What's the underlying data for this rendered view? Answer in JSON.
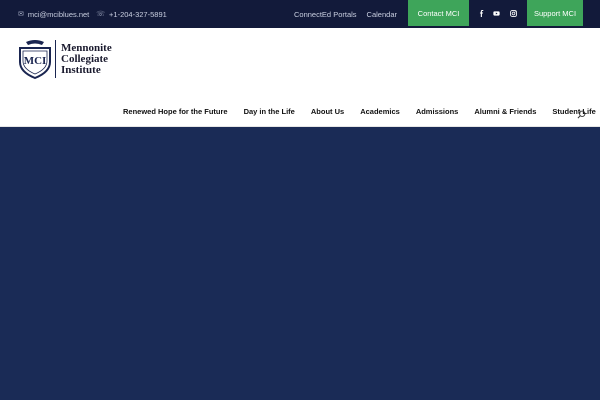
{
  "topbar": {
    "email": "mci@mciblues.net",
    "phone": "+1-204-327-5891",
    "email_icon": "mail-icon",
    "phone_icon": "phone-icon",
    "links": [
      "ConnectEd Portals",
      "Calendar"
    ],
    "contact_label": "Contact MCI",
    "support_label": "Support MCI",
    "social": [
      "facebook-icon",
      "youtube-icon",
      "instagram-icon"
    ]
  },
  "header": {
    "logo_lines": [
      "Mennonite",
      "Collegiate",
      "Institute"
    ],
    "crest_letters": "MCI"
  },
  "nav": {
    "items": [
      "Renewed Hope for the Future",
      "Day in the Life",
      "About Us",
      "Academics",
      "Admissions",
      "Alumni & Friends",
      "Student Life"
    ]
  },
  "colors": {
    "topbar_bg": "#121a3a",
    "accent_green": "#3ea55a",
    "hero_bg": "#1a2b56"
  }
}
